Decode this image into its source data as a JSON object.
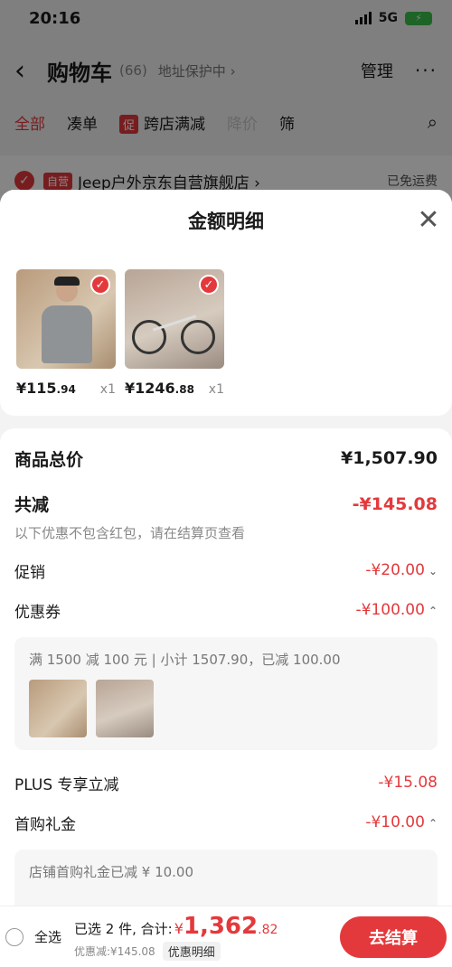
{
  "status_bar": {
    "time": "20:16",
    "network": "5G"
  },
  "nav": {
    "title": "购物车",
    "count": "(66)",
    "address_protect": "地址保护中 ›",
    "manage": "管理"
  },
  "filters": {
    "all": "全部",
    "combine": "凑单",
    "promo_badge": "促",
    "cross_store": "跨店满减",
    "price_drop": "降价",
    "filter": "筛"
  },
  "store": {
    "badge": "自营",
    "name": "Jeep户外京东自营旗舰店 ›",
    "shipping": "已免运费"
  },
  "sheet": {
    "title": "金额明细",
    "products": [
      {
        "name": "shirt",
        "price_int": "¥115",
        "price_dec": ".94",
        "qty": "x1"
      },
      {
        "name": "bike",
        "price_int": "¥1246",
        "price_dec": ".88",
        "qty": "x1"
      }
    ],
    "total_label": "商品总价",
    "total_value": "¥1,507.90",
    "reduce_label": "共减",
    "reduce_value": "-¥145.08",
    "note": "以下优惠不包含红包，请在结算页查看",
    "promo_label": "促销",
    "promo_value": "-¥20.00",
    "coupon_label": "优惠券",
    "coupon_value": "-¥100.00",
    "coupon_detail": "满 1500 减 100 元 | 小计 1507.90，已减 100.00",
    "plus_label": "PLUS 专享立减",
    "plus_value": "-¥15.08",
    "gift_label": "首购礼金",
    "gift_value": "-¥10.00",
    "gift_detail": "店铺首购礼金已减 ¥ 10.00"
  },
  "checkout": {
    "select_all": "全选",
    "selected": "已选 2 件, 合计:",
    "yen": "¥",
    "total_int": "1,362",
    "total_dec": ".82",
    "discount": "优惠减:¥145.08",
    "detail_btn": "优惠明细",
    "pay_btn": "去结算"
  }
}
